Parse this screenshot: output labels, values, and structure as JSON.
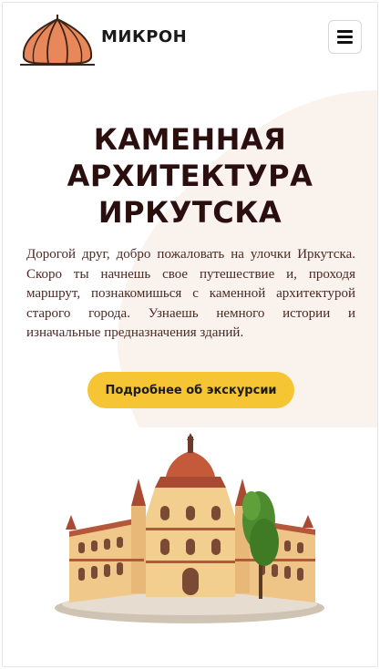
{
  "header": {
    "brand": "МИКРОН",
    "logo_icon": "onion-dome-logo",
    "menu_icon": "hamburger-menu-icon"
  },
  "hero": {
    "title_lines": [
      "КАМЕННАЯ",
      "АРХИТЕКТУРА",
      "ИРКУТСКА"
    ],
    "description": "Дорогой друг, добро пожаловать на улочки Иркутска. Скоро ты начнешь свое путешествие и, проходя маршрут, познакомишься с каменной архитектурой старого города. Узнаешь немного истории и изначальные предназначения зданий.",
    "cta_label": "Подробнее об экскурсии",
    "illustration": "historic-building-illustration"
  },
  "colors": {
    "accent": "#f5c533",
    "title": "#2a0f0e",
    "text": "#4a2a25",
    "hero_bg": "#f9f1ea",
    "logo_dome": "#e8875a"
  }
}
